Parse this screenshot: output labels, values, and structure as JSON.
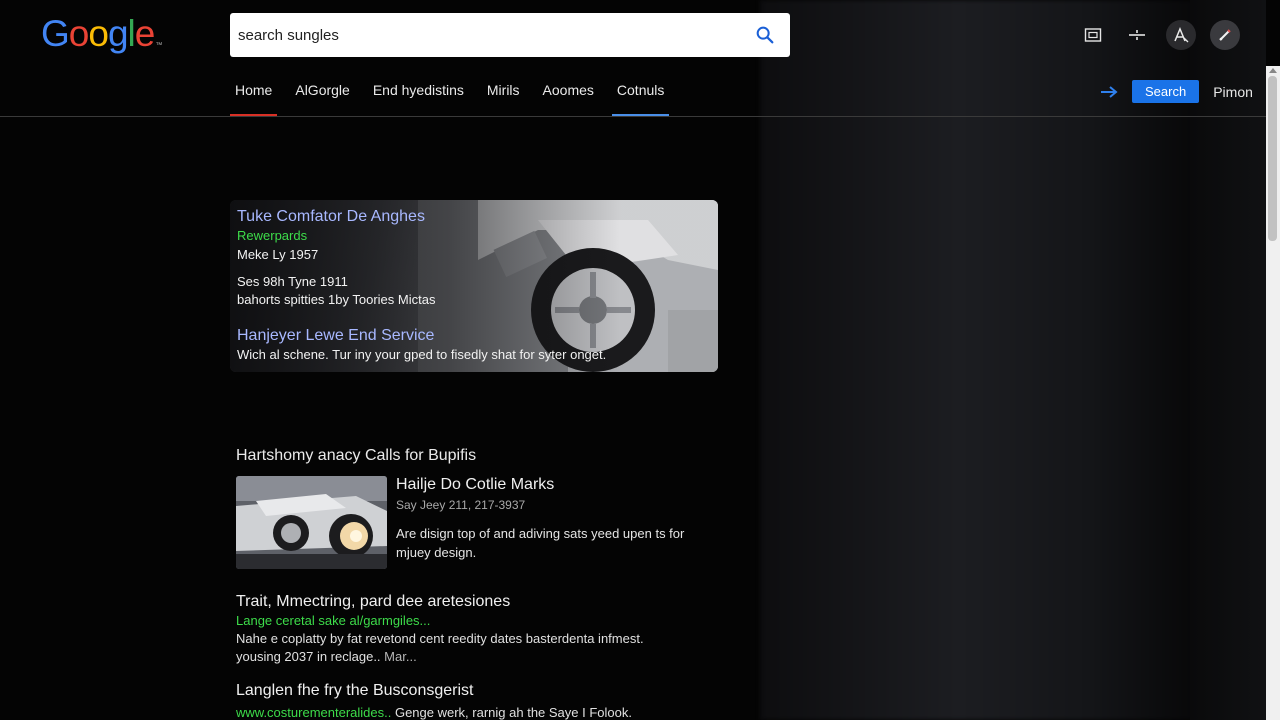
{
  "logo": {
    "letters": [
      {
        "char": "G",
        "color": "#4285f4"
      },
      {
        "char": "o",
        "color": "#ea4335"
      },
      {
        "char": "o",
        "color": "#fbbc05"
      },
      {
        "char": "g",
        "color": "#4285f4"
      },
      {
        "char": "l",
        "color": "#34a853"
      },
      {
        "char": "e",
        "color": "#ea4335"
      }
    ],
    "tm": "™"
  },
  "search": {
    "value": "search sungles"
  },
  "top_icons": [
    "image-search-icon",
    "settings-slider-icon",
    "translate-icon",
    "pen-tool-icon"
  ],
  "nav": {
    "items": [
      {
        "label": "Home"
      },
      {
        "label": "AlGorgle"
      },
      {
        "label": "End hyedistins"
      },
      {
        "label": "Mirils"
      },
      {
        "label": "Aoomes"
      },
      {
        "label": "Cotnuls"
      }
    ],
    "search_button": "Search",
    "account_label": "Pimon"
  },
  "featured": {
    "title": "Tuke Comfator De Anghes",
    "green": "Rewerpards",
    "line1": "Meke Ly 1957",
    "line2": "Ses 98h Tyne 1911",
    "line3": "bahorts spitties 1by Toories Mictas",
    "subtitle": "Hanjeyer Lewe End Service",
    "desc": "Wich al schene. Tur iny your gped to fisedly shat for syter onget."
  },
  "results_heading": "Hartshomy anacy Calls for Bupifis",
  "rich_result": {
    "title": "Hailje Do Cotlie Marks",
    "meta": "Say Jeey 211, 217-3937",
    "desc": "Are disign top of and adiving sats yeed upen ts for mjuey design."
  },
  "result2": {
    "title": "Trait, Mmectring, pard dee aretesiones",
    "url": "Lange ceretal sake al/garmgiles...",
    "desc_1": "Nahe e coplatty by fat revetond cent reedity dates basterdenta infmest.",
    "desc_2": "yousing 2037 in reclage..",
    "desc_more": "Mar..."
  },
  "result3": {
    "title": "Langlen fhe fry the Busconsgerist",
    "url": "www.costurementeralides..",
    "desc": "Genge werk, rarnig ah the Saye I Folook."
  },
  "colors": {
    "link_blue": "#a8b8ff",
    "url_green": "#3ddc4a",
    "accent_blue": "#1a73e8",
    "nav_red": "#d93025"
  }
}
